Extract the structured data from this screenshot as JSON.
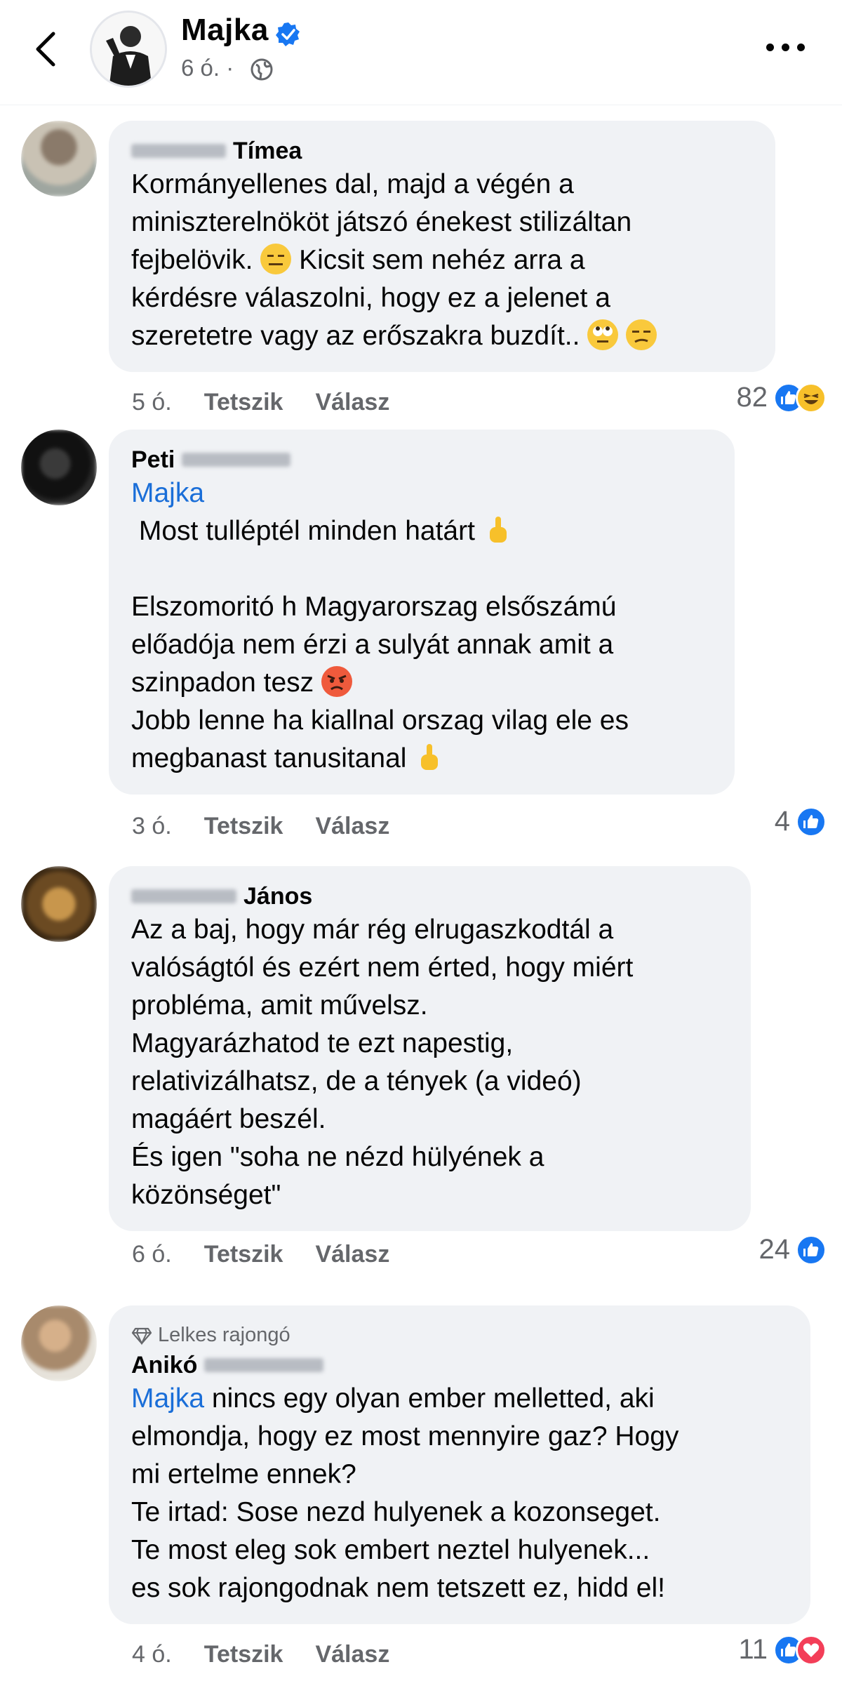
{
  "header": {
    "page_name": "Majka",
    "post_age": "6 ó. ·",
    "more_label": "..."
  },
  "actions": {
    "like": "Tetszik",
    "reply": "Válasz"
  },
  "comments": [
    {
      "author_visible": "Tímea",
      "lines": [
        "Kormányellenes dal, majd a végén a",
        "miniszterelnököt játszó énekest stilizáltan",
        "fejbelövik. [expressionless] Kicsit sem nehéz arra a",
        "kérdésre válaszolni, hogy ez a jelenet a",
        "szeretetre vagy az erőszakra buzdít.. [eye-roll] [unamused]"
      ],
      "text_parts": [
        "Kormányellenes dal, majd a végén a\nminiszterelnököt játszó énekest stilizáltan\nfejbelövik. ",
        " Kicsit sem nehéz arra a\nkérdésre válaszolni, hogy ez a jelenet a\nszeretetre vagy az erőszakra buzdít.. "
      ],
      "age": "5 ó.",
      "reaction_count": "82",
      "reactions": [
        "like",
        "haha"
      ]
    },
    {
      "author_visible": "Peti",
      "mention": "Majka",
      "text_parts": [
        " Most tulléptél minden határt ",
        "\n\nElszomoritó h Magyarorszag elsőszámú\nelőadója nem érzi a sulyát annak amit a\nszinpadon tesz ",
        "\nJobb lenne ha kiallnal orszag vilag ele es\nmegbanast tanusitanal "
      ],
      "age": "3 ó.",
      "reaction_count": "4",
      "reactions": [
        "like"
      ]
    },
    {
      "author_visible": "János",
      "text": "Az a baj, hogy már rég elrugaszkodtál a\nvalóságtól és ezért nem érted, hogy miért\nprobléma, amit művelsz.\nMagyarázhatod te ezt napestig,\nrelativizálhatsz, de a tények (a videó)\nmagáért beszél.\nÉs igen \"soha ne nézd hülyének a\nközönséget\"",
      "age": "6 ó.",
      "reaction_count": "24",
      "reactions": [
        "like"
      ]
    },
    {
      "badge": "Lelkes rajongó",
      "author_visible": "Anikó",
      "mention": "Majka",
      "text": " nincs egy olyan ember melletted, aki\nelmondja, hogy ez most mennyire gaz? Hogy\nmi ertelme ennek?\nTe irtad: Sose nezd hulyenek a kozonseget.\nTe most eleg sok embert neztel hulyenek...\nes sok rajongodnak nem tetszett ez, hidd el!",
      "age": "4 ó.",
      "reaction_count": "11",
      "reactions": [
        "like",
        "love"
      ]
    }
  ],
  "colors": {
    "bubble": "#f0f2f5",
    "mention": "#1a6ed8",
    "like": "#1877f2",
    "love": "#f33e58",
    "haha": "#f7c02a",
    "meta": "#65676b"
  }
}
